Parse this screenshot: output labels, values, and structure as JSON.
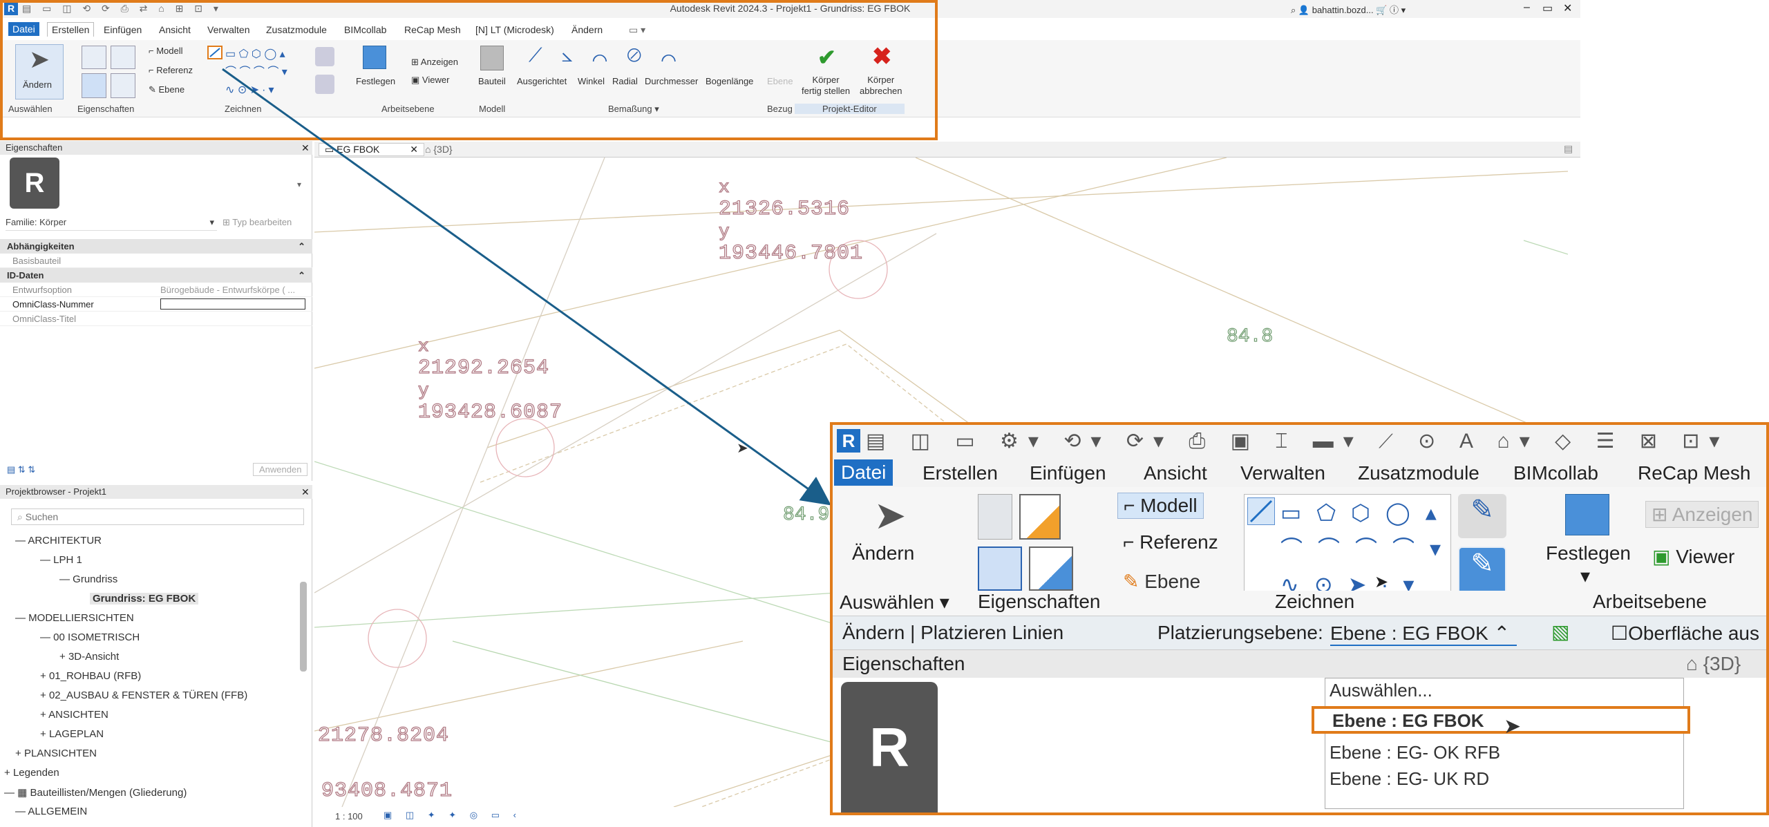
{
  "app": {
    "window_title": "Autodesk Revit 2024.3 - Projekt1 - Grundriss: EG FBOK",
    "user": "bahattin.bozd...",
    "win_controls": [
      "–",
      "▭",
      "✕"
    ]
  },
  "tabs": [
    "Datei",
    "Erstellen",
    "Einfügen",
    "Ansicht",
    "Verwalten",
    "Zusatzmodule",
    "BIMcollab",
    "ReCap Mesh",
    "[N] LT (Microdesk)",
    "Ändern"
  ],
  "ribbon": {
    "aendern": "Ändern",
    "auswaehlen": "Auswählen",
    "eigenschaften": "Eigenschaften",
    "modell": "Modell",
    "referenz": "Referenz",
    "ebene": "Ebene",
    "zeichnen": "Zeichnen",
    "festlegen": "Festlegen",
    "anzeigen": "Anzeigen",
    "viewer": "Viewer",
    "arbeitsebene": "Arbeitsebene",
    "bauteil": "Bauteil",
    "modell_group": "Modell",
    "ausgerichtet": "Ausgerichtet",
    "winkel": "Winkel",
    "radial": "Radial",
    "durchmesser": "Durchmesser",
    "bogenlaenge": "Bogenlänge",
    "bemassung": "Bemaßung",
    "ebene_disabled": "Ebene",
    "bezug": "Bezug",
    "koerper_fertig": [
      "Körper",
      "fertig stellen"
    ],
    "koerper_abbrechen": [
      "Körper",
      "abbrechen"
    ],
    "projekt_editor": "Projekt-Editor"
  },
  "properties": {
    "title": "Eigenschaften",
    "logo_letter": "R",
    "familie": "Familie: Körper",
    "typ_bearbeiten": "Typ bearbeiten",
    "sections": {
      "abhaengigkeiten": "Abhängigkeiten",
      "id_daten": "ID-Daten"
    },
    "rows": [
      {
        "k": "Basisbauteil",
        "v": ""
      },
      {
        "k": "Entwurfsoption",
        "v": "Bürogebäude - Entwurfskörpe ( ..."
      },
      {
        "k": "OmniClass-Nummer",
        "v": ""
      },
      {
        "k": "OmniClass-Titel",
        "v": ""
      }
    ],
    "apply": "Anwenden"
  },
  "browser": {
    "title": "Projektbrowser - Projekt1",
    "search_placeholder": "Suchen",
    "items": [
      "ARCHITEKTUR",
      "LPH 1",
      "Grundriss",
      "Grundriss: EG FBOK",
      "MODELLIERSICHTEN",
      "00 ISOMETRISCH",
      "3D-Ansicht",
      "01_ROHBAU (RFB)",
      "02_AUSBAU & FENSTER & TÜREN (FFB)",
      "ANSICHTEN",
      "LAGEPLAN",
      "PLANSICHTEN",
      "Legenden",
      "Bauteillisten/Mengen (Gliederung)",
      "ALLGEMEIN"
    ]
  },
  "view_tabs": [
    "EG FBOK",
    "{3D}"
  ],
  "canvas": {
    "coord1": {
      "x_label": "x",
      "x": "21326.5316",
      "y_label": "y",
      "y": "193446.7801"
    },
    "coord2": {
      "x_label": "x",
      "x": "21292.2654",
      "y_label": "y",
      "y": "193428.6087"
    },
    "coord3": {
      "x": "21278.8204",
      "y": "93408.4871"
    },
    "label_848": "84.8",
    "label_849": "84.9",
    "scale": "1 : 100"
  },
  "zoom": {
    "tabs": [
      "Datei",
      "Erstellen",
      "Einfügen",
      "Ansicht",
      "Verwalten",
      "Zusatzmodule",
      "BIMcollab",
      "ReCap Mesh"
    ],
    "aendern": "Ändern",
    "modell": "Modell",
    "referenz": "Referenz",
    "ebene": "Ebene",
    "festlegen": "Festlegen",
    "anzeigen": "Anzeigen",
    "viewer": "Viewer",
    "auswaehlen": "Auswählen",
    "eigenschaften": "Eigenschaften",
    "zeichnen": "Zeichnen",
    "arbeitsebene": "Arbeitsebene",
    "context": "Ändern | Platzieren Linien",
    "placement_label": "Platzierungsebene:",
    "placement_value": "Ebene : EG FBOK",
    "oberflaeche": "Oberfläche aus",
    "props_title": "Eigenschaften",
    "view_3d": "{3D}",
    "dropdown": [
      "Auswählen...",
      "Ebene : EG FBOK",
      "Ebene : EG- OK RFB",
      "Ebene : EG- UK RD"
    ]
  },
  "colors": {
    "accent": "#1f6fc4",
    "highlight": "#e07b1a",
    "arrow": "#1a5e8a",
    "red": "#d6231d",
    "green": "#2e9a2e"
  }
}
